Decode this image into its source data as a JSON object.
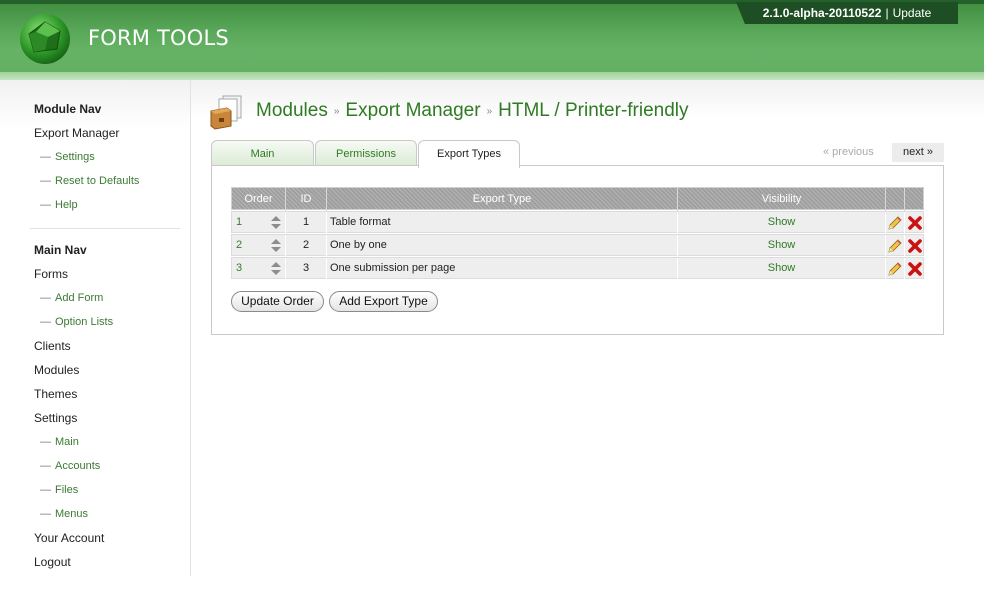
{
  "header": {
    "logo_text": "FORM TOOLS",
    "version": "2.1.0-alpha-20110522",
    "version_sep": "|",
    "update_link": "Update"
  },
  "sidebar": {
    "module_nav_heading": "Module Nav",
    "module_nav": [
      {
        "label": "Export Manager",
        "type": "item"
      },
      {
        "label": "Settings",
        "type": "sub"
      },
      {
        "label": "Reset to Defaults",
        "type": "sub"
      },
      {
        "label": "Help",
        "type": "sub"
      }
    ],
    "main_nav_heading": "Main Nav",
    "main_nav": [
      {
        "label": "Forms",
        "type": "item"
      },
      {
        "label": "Add Form",
        "type": "sub"
      },
      {
        "label": "Option Lists",
        "type": "sub"
      },
      {
        "label": "Clients",
        "type": "item"
      },
      {
        "label": "Modules",
        "type": "item"
      },
      {
        "label": "Themes",
        "type": "item"
      },
      {
        "label": "Settings",
        "type": "item"
      },
      {
        "label": "Main",
        "type": "sub"
      },
      {
        "label": "Accounts",
        "type": "sub"
      },
      {
        "label": "Files",
        "type": "sub"
      },
      {
        "label": "Menus",
        "type": "sub"
      },
      {
        "label": "Your Account",
        "type": "item"
      },
      {
        "label": "Logout",
        "type": "item"
      }
    ]
  },
  "breadcrumb": {
    "modules": "Modules",
    "export_manager": "Export Manager",
    "current": "HTML / Printer-friendly",
    "sep": "»"
  },
  "tabs": {
    "main": "Main",
    "permissions": "Permissions",
    "export_types": "Export Types"
  },
  "pager": {
    "previous": "« previous",
    "next": "next »"
  },
  "table": {
    "headers": {
      "order": "Order",
      "id": "ID",
      "export_type": "Export Type",
      "visibility": "Visibility"
    },
    "rows": [
      {
        "order": "1",
        "id": "1",
        "type": "Table format",
        "visibility": "Show"
      },
      {
        "order": "2",
        "id": "2",
        "type": "One by one",
        "visibility": "Show"
      },
      {
        "order": "3",
        "id": "3",
        "type": "One submission per page",
        "visibility": "Show"
      }
    ]
  },
  "buttons": {
    "update_order": "Update Order",
    "add_export_type": "Add Export Type"
  },
  "colors": {
    "brand_green": "#2f7a23",
    "header_dark": "#1e4f24",
    "delete_red": "#cc1111"
  },
  "icons": {
    "logo": "gem-logo-icon",
    "module": "module-box-icon",
    "sort": "sort-arrows-icon",
    "edit": "pencil-edit-icon",
    "delete": "red-x-delete-icon"
  }
}
